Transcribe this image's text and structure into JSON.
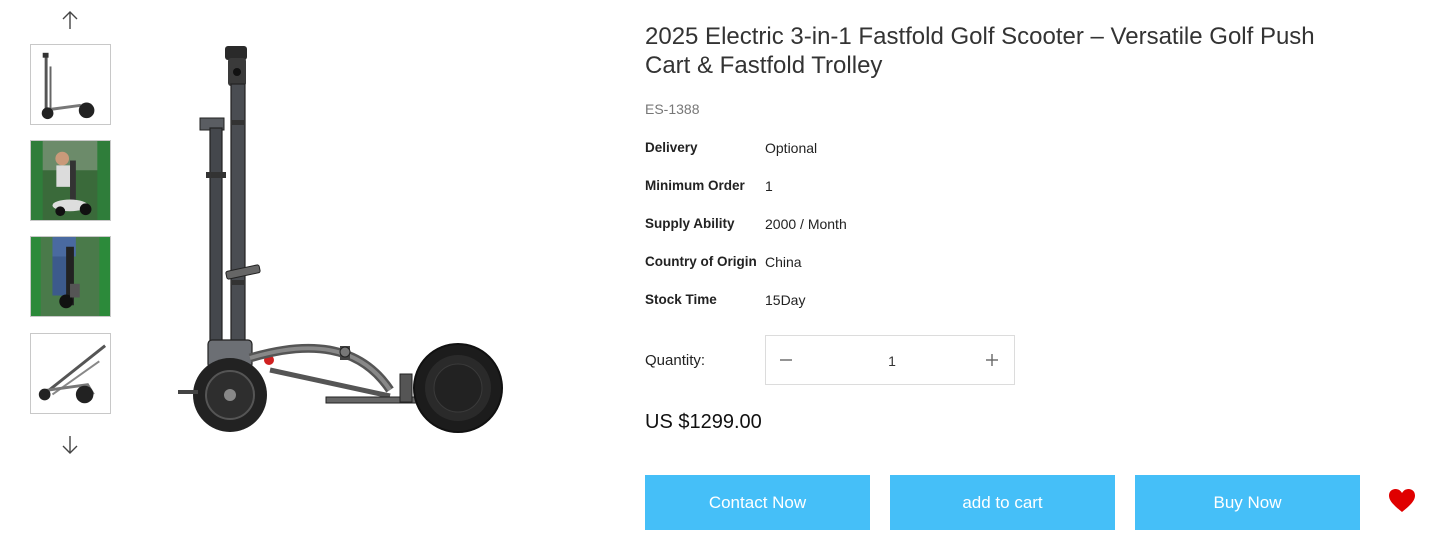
{
  "product": {
    "title": "2025 Electric 3-in-1 Fastfold Golf Scooter – Versatile Golf Push Cart & Fastfold Trolley",
    "sku": "ES-1388",
    "specs": [
      {
        "label": "Delivery",
        "value": "Optional"
      },
      {
        "label": "Minimum Order",
        "value": "1"
      },
      {
        "label": "Supply Ability",
        "value": "2000 / Month"
      },
      {
        "label": "Country of Origin",
        "value": "China"
      },
      {
        "label": "Stock Time",
        "value": "15Day"
      }
    ],
    "quantity_label": "Quantity:",
    "quantity_value": "1",
    "price": "US $1299.00"
  },
  "buttons": {
    "contact": "Contact Now",
    "cart": "add to cart",
    "buy": "Buy Now"
  },
  "gallery": {
    "thumbnail_count": 4,
    "icons": [
      "arrow-up-icon",
      "arrow-down-icon",
      "heart-icon",
      "minus-icon",
      "plus-icon"
    ]
  },
  "colors": {
    "button_bg": "#45bff8",
    "button_text": "#ffffff",
    "heart": "#e00000"
  }
}
